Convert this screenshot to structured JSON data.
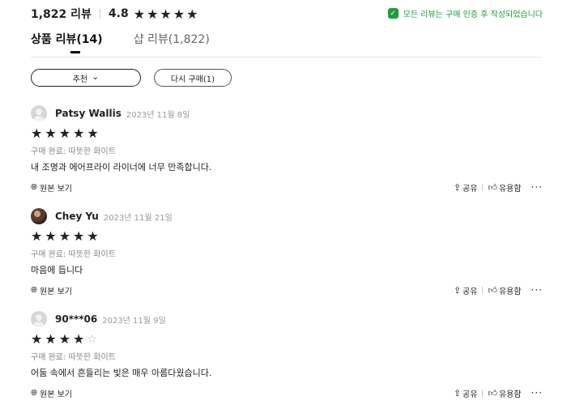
{
  "summary": {
    "review_count": "1,822 리뷰",
    "rating": "4.8",
    "stars": [
      "★",
      "★",
      "★",
      "★",
      "★"
    ]
  },
  "verified_notice": "모든 리뷰는 구매 인증 후 작성되었습니다",
  "tabs": [
    {
      "label": "상품 리뷰(14)",
      "active": true
    },
    {
      "label": "샵 리뷰(1,822)",
      "active": false
    }
  ],
  "filters": {
    "sort_label": "추천",
    "sort_chevron": "⌄",
    "repurchase_label": "다시 구매(1)"
  },
  "reviews": [
    {
      "name": "Patsy Wallis",
      "date": "2023년 11월 8일",
      "rating": 5,
      "variant": "구매 완료: 따뜻한 화이트",
      "text": "내 조명과 에어프라이 라이너에 너무 만족합니다.",
      "avatar": "default-avatar"
    },
    {
      "name": "Chey Yu",
      "date": "2023년 11월 21일",
      "rating": 5,
      "variant": "구매 완료: 따뜻한 화이트",
      "text": "마음에 듭니다",
      "avatar": "photo-avatar"
    },
    {
      "name": "90***06",
      "date": "2023년 11월 9일",
      "rating": 4,
      "variant": "구매 완료: 따뜻한 화이트",
      "text": "어둠 속에서 흔들리는 빛은 매우 아름다웠습니다.",
      "avatar": "default-avatar"
    }
  ],
  "actions": {
    "original_label": "원본 보기",
    "share_label": "공유",
    "helpful_label": "유용함",
    "more_label": "···"
  },
  "colors": {
    "verified_green": "#1a9f3b",
    "text": "#222222",
    "muted": "#999999"
  },
  "icons": {
    "verified": "shield-check-icon",
    "globe": "globe-icon",
    "share": "share-icon",
    "helpful": "thumbs-up-icon",
    "more": "ellipsis-icon"
  }
}
